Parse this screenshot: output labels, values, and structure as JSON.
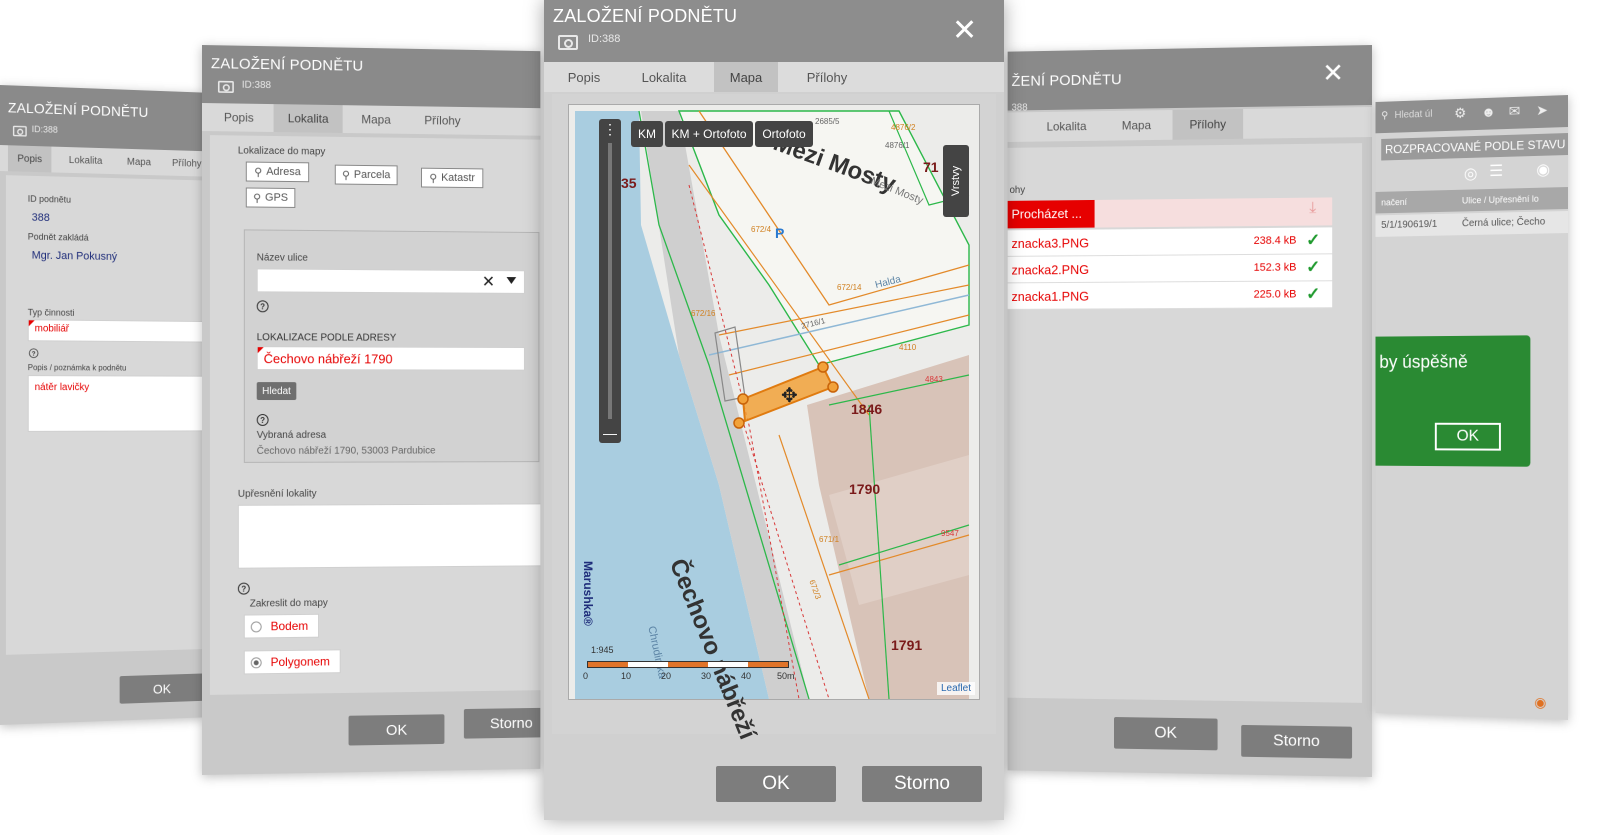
{
  "dialog_title": "ZALOŽENÍ PODNĚTU",
  "dialog_id": "ID:388",
  "tabs": {
    "popis": "Popis",
    "lokalita": "Lokalita",
    "mapa": "Mapa",
    "prilohy": "Přílohy"
  },
  "buttons": {
    "ok": "OK",
    "storno": "Storno"
  },
  "popis_panel": {
    "id_label": "ID podnětu",
    "id_value": "388",
    "zaklada_label": "Podnět zakládá",
    "zaklada_value": "Mgr. Jan Pokusný",
    "typ_label": "Typ činnosti",
    "typ_value": "mobiliář",
    "note_label": "Popis / poznámka k podnětu",
    "note_value": "nátěr lavičky"
  },
  "lokalita_panel": {
    "section_label": "Lokalizace do mapy",
    "btn_adresa": "Adresa",
    "btn_parcela": "Parcela",
    "btn_katastr": "Katastr",
    "btn_gps": "GPS",
    "street_label": "Název ulice",
    "street_value": "",
    "address_label": "LOKALIZACE PODLE ADRESY",
    "address_value": "Čechovo nábřeží 1790",
    "search_btn": "Hledat",
    "selected_label": "Vybraná adresa",
    "selected_value": "Čechovo nábřeží 1790, 53003 Pardubice",
    "upresneni_label": "Upřesnění lokality",
    "draw_label": "Zakreslit do mapy",
    "opt_bodem": "Bodem",
    "opt_polygonem": "Polygonem",
    "selected_option": "Polygonem"
  },
  "map_panel": {
    "layer_btns": [
      "KM",
      "KM + Ortofoto",
      "Ortofoto"
    ],
    "layers_label": "Vrstvy",
    "attribution": "Leaflet",
    "watermark": "Marushka®",
    "scale_denominator": "1:945",
    "scale_ticks": [
      "0",
      "10",
      "20",
      "30",
      "40",
      "50m"
    ],
    "street_big": "Čechovo nábřeží",
    "street_top": "Mezi Mosty",
    "street_small": "Mezi Mosty",
    "river": "Chrudimka",
    "halda": "Halda",
    "parcels": [
      "1846",
      "1790",
      "1791",
      "35",
      "71"
    ],
    "small_labels": [
      "2685/5",
      "4876/2",
      "4876/1",
      "672/4",
      "672/16",
      "672/14",
      "2716/1",
      "4110",
      "4843",
      "9547",
      "671/1",
      "672/3"
    ]
  },
  "prilohy_panel": {
    "section_label": "ohy",
    "browse_label": "Procházet ...",
    "files": [
      {
        "name": "znacka3.PNG",
        "size": "238.4 kB"
      },
      {
        "name": "znacka2.PNG",
        "size": "152.3 kB"
      },
      {
        "name": "znacka1.PNG",
        "size": "225.0 kB"
      }
    ]
  },
  "right_panel": {
    "search_placeholder": "Hledat úl",
    "heading": "ROZPRACOVANÉ PODLE STAVU",
    "col_oznaceni": "načení",
    "col_ulice": "Ulice / Upřesnění lo",
    "row_code": "5/1/190619/1",
    "row_street": "Černá ulice; Čecho",
    "success_text": "by úspěšně",
    "success_ok": "OK"
  },
  "colors": {
    "accent_red": "#e60000",
    "success_green": "#2a8a33",
    "header_gray": "#8a8a8a"
  }
}
